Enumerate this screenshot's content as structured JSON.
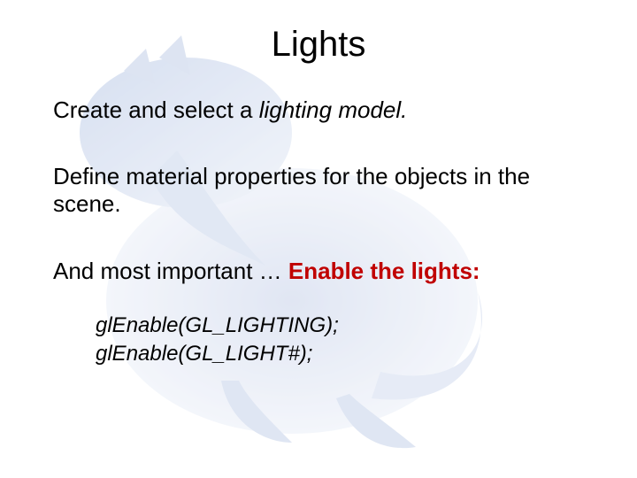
{
  "title": "Lights",
  "p1_a": "Create and select a ",
  "p1_b": "lighting model.",
  "p2": "Define material properties for the objects in the scene.",
  "p3_a": "And most important … ",
  "p3_b": "Enable the lights:",
  "code1": "glEnable(GL_LIGHTING);",
  "code2": "glEnable(GL_LIGHT#);"
}
